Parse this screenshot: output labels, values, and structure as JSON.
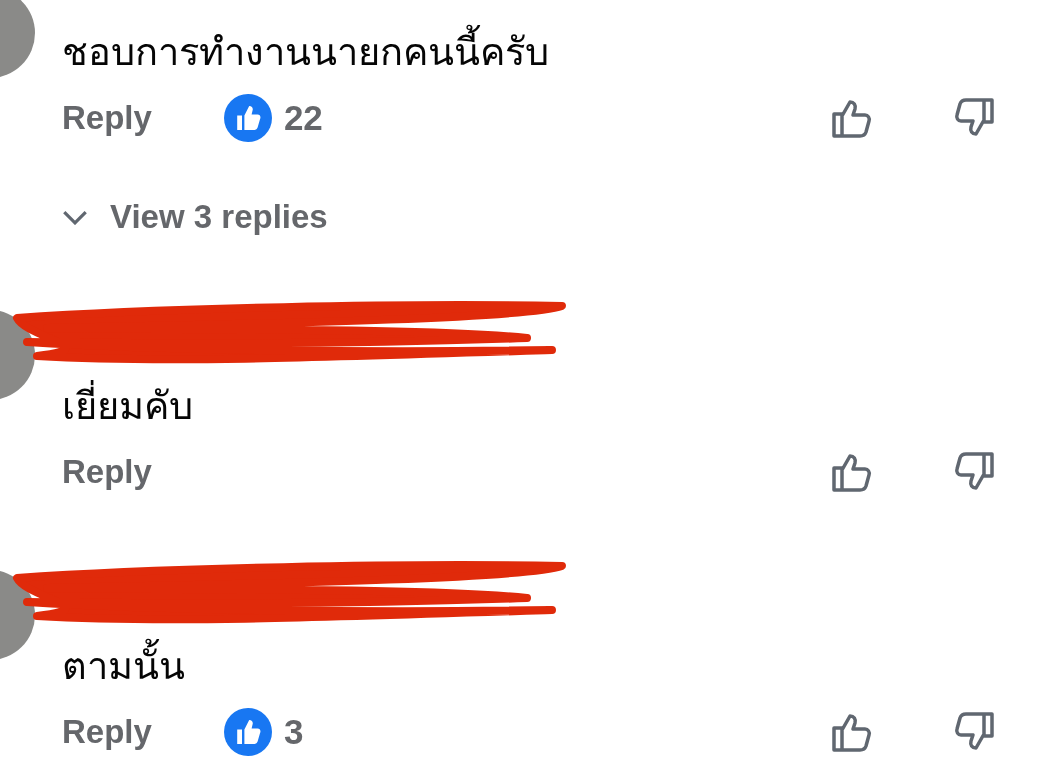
{
  "comments": [
    {
      "name_redacted": false,
      "text": "ชอบการทำงานนายกคนนี้ครับ",
      "reply_label": "Reply",
      "like_count": "22",
      "view_replies": "View 3 replies"
    },
    {
      "name_redacted": true,
      "text": "เยี่ยมคับ",
      "reply_label": "Reply"
    },
    {
      "name_redacted": true,
      "text": "ตามนั้น",
      "reply_label": "Reply",
      "like_count": "3"
    }
  ]
}
